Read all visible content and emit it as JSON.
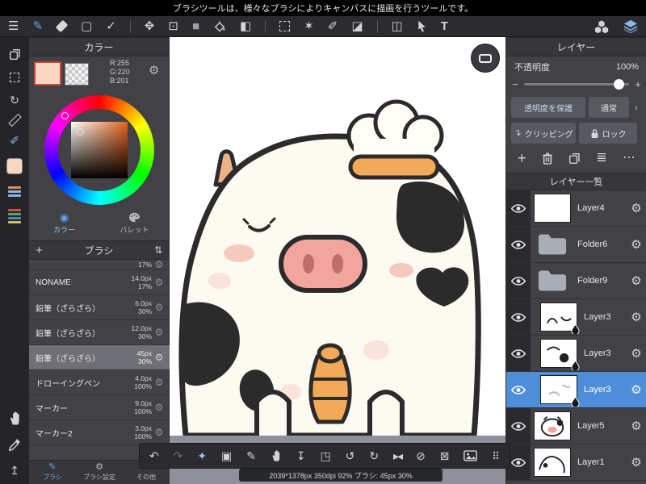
{
  "top_bar": {
    "message": "ブラシツールは、様々なブラシによりキャンバスに描画を行うツールです。"
  },
  "icons": {
    "menu": "☰",
    "brush": "✎",
    "rect": "▢",
    "check": "✓",
    "move": "✥",
    "transform": "⊡",
    "fg_square": "■",
    "gradient": "◧",
    "wand": "✶",
    "select_pen": "✐",
    "select_eraser": "◪",
    "split": "◫",
    "text": "T",
    "sort": "⇅",
    "plus": "+",
    "gear": "⚙",
    "dots_h": "⋯",
    "list": "≣",
    "minus": "−",
    "chevron": "›",
    "refresh": "↻",
    "rail_pen": "✐",
    "arrow_up": "↥",
    "undo": "↶",
    "redo": "↷",
    "stabilize": "✦",
    "fill_square": "▣",
    "pen": "✎",
    "save": "↧",
    "frame": "◳",
    "rotate_ccw": "↺",
    "rotate_cw": "↻",
    "flip": "▸◂",
    "ban": "⊘",
    "clear": "⊠",
    "grid": "⠿",
    "color_tab": "◉",
    "clip_arrow": "↴"
  },
  "color_panel": {
    "title": "カラー",
    "rgb": {
      "r": "R:255",
      "g": "G:220",
      "b": "B:201"
    },
    "swatch_hex": "#f8d8c2",
    "tabs": [
      {
        "label": "カラー"
      },
      {
        "label": "パレット"
      }
    ]
  },
  "brush_panel": {
    "title": "ブラシ",
    "selected_index": 4,
    "brushes": [
      {
        "name": "",
        "size": "",
        "opacity": "17%"
      },
      {
        "name": "NONAME",
        "size": "14.0px",
        "opacity": "17%"
      },
      {
        "name": "鉛筆（ざらざら）",
        "size": "6.0px",
        "opacity": "30%"
      },
      {
        "name": "鉛筆（ざらざら）",
        "size": "12.0px",
        "opacity": "30%"
      },
      {
        "name": "鉛筆（ざらざら）",
        "size": "45px",
        "opacity": "30%"
      },
      {
        "name": "ドローイングペン",
        "size": "4.0px",
        "opacity": "100%"
      },
      {
        "name": "マーカー",
        "size": "9.0px",
        "opacity": "100%"
      },
      {
        "name": "マーカー2",
        "size": "3.0px",
        "opacity": "100%"
      }
    ],
    "tabs": [
      {
        "label": "ブラシ"
      },
      {
        "label": "ブラシ設定"
      },
      {
        "label": "その他"
      }
    ]
  },
  "layer_panel": {
    "title": "レイヤー",
    "opacity": {
      "label": "不透明度",
      "value": "100%"
    },
    "buttons": {
      "protect": "透明度を保護",
      "blend": "通常",
      "clipping": "クリッピング",
      "lock": "ロック"
    },
    "list_title": "レイヤー一覧",
    "selected_index": 5,
    "layers": [
      {
        "name": "Layer4",
        "type": "layer"
      },
      {
        "name": "Folder6",
        "type": "folder"
      },
      {
        "name": "Folder9",
        "type": "folder"
      },
      {
        "name": "Layer3",
        "type": "layer"
      },
      {
        "name": "Layer3",
        "type": "layer"
      },
      {
        "name": "Layer3",
        "type": "layer"
      },
      {
        "name": "Layer5",
        "type": "layer"
      },
      {
        "name": "Layer1",
        "type": "layer"
      }
    ]
  },
  "status_bar": {
    "text": "2039*1378px 350dpi 92% ブラシ: 45px 30%"
  }
}
